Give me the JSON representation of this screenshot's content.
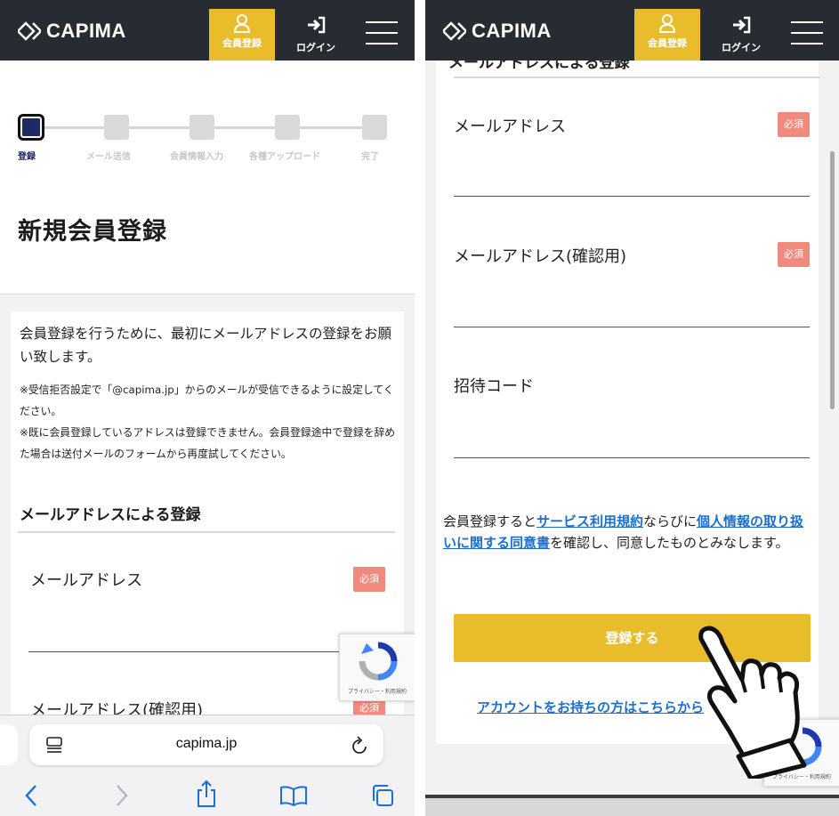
{
  "header": {
    "logo": "CAPIMA",
    "register_label": "会員登録",
    "login_label": "ログイン"
  },
  "progress": {
    "steps": [
      "登録",
      "メール送信",
      "会員情報入力",
      "各種アップロード",
      "完了"
    ],
    "current_index": 0
  },
  "page_title": "新規会員登録",
  "intro": "会員登録を行うために、最初にメールアドレスの登録をお願い致します。",
  "notes": [
    "※受信拒否設定で「@capima.jp」からのメールが受信できるように設定してください。",
    "※既に会員登録しているアドレスは登録できません。会員登録途中で登録を辞めた場合は送付メールのフォームから再度試してください。"
  ],
  "section_title": "メールアドレスによる登録",
  "fields": {
    "email_label": "メールアドレス",
    "email_confirm_label": "メールアドレス(確認用)",
    "invite_label": "招待コード",
    "required_badge": "必須"
  },
  "recaptcha": {
    "caption": "プライバシー・利用規約"
  },
  "browser": {
    "url": "capima.jp"
  },
  "consent": {
    "prefix": "会員登録すると",
    "terms_link": "サービス利用規約",
    "middle": "ならびに",
    "privacy_link": "個人情報の取り扱いに関する同意書",
    "suffix": "を確認し、同意したものとみなします。"
  },
  "register_button": "登録する",
  "account_link": "アカウントをお持ちの方はこちらから",
  "colors": {
    "header_bg": "#272c33",
    "accent": "#e9bc2c",
    "required": "#f08a7c",
    "link": "#1a6fcf",
    "step_active": "#1d2a66"
  }
}
